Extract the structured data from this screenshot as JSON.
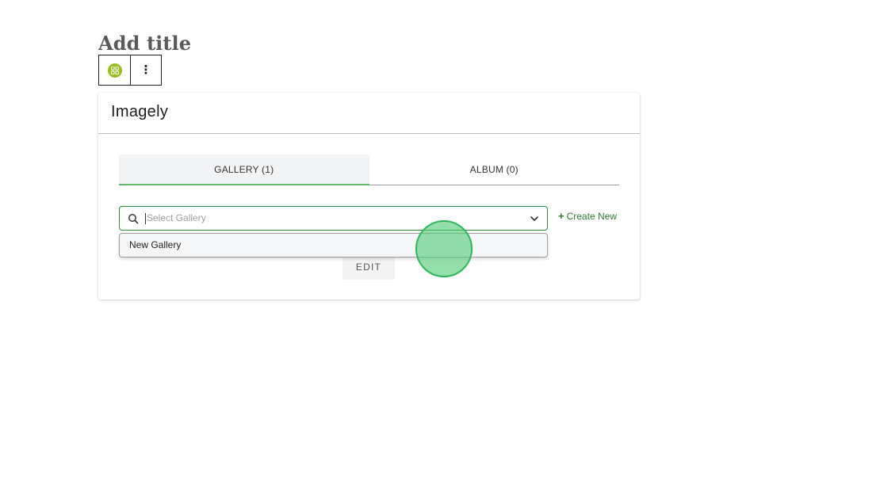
{
  "editor": {
    "post_title_placeholder": "Add title"
  },
  "toolbar": {
    "block_icon": "imagely-grid-icon",
    "more_options_icon": "vertical-ellipsis-icon",
    "more_options_glyph": "⋮",
    "block_icon_color": "#9bbf21"
  },
  "block": {
    "title": "Imagely",
    "tabs": [
      {
        "label": "GALLERY (1)",
        "active": true
      },
      {
        "label": "ALBUM (0)",
        "active": false
      }
    ],
    "select": {
      "placeholder": "Select Gallery",
      "value": "",
      "search_icon": "search-icon",
      "dropdown_icon": "chevron-down-icon"
    },
    "create_new": {
      "icon": "plus-icon",
      "plus_glyph": "+",
      "label": "Create New"
    },
    "dropdown_options": [
      "New Gallery"
    ],
    "edit_label": "EDIT"
  },
  "colors": {
    "accent_green": "#2e7d32",
    "active_tab_underline": "#66bb6a",
    "click_marker": "#4cc975"
  }
}
